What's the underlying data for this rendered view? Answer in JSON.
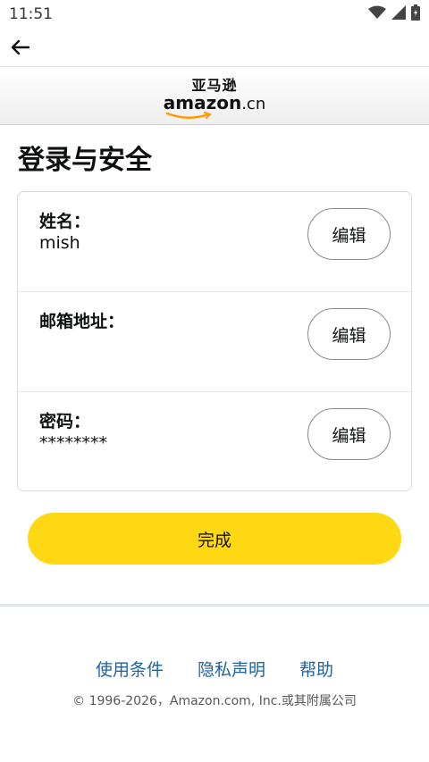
{
  "status_bar": {
    "time": "11:51"
  },
  "logo": {
    "cn": "亚马逊",
    "en": "amazon",
    "suffix": ".cn"
  },
  "page": {
    "title": "登录与安全"
  },
  "rows": [
    {
      "label": "姓名：",
      "value": "mish",
      "button": "编辑"
    },
    {
      "label": "邮箱地址：",
      "value": "",
      "button": "编辑"
    },
    {
      "label": "密码：",
      "value": "********",
      "button": "编辑"
    }
  ],
  "done_button": "完成",
  "footer": {
    "links": [
      "使用条件",
      "隐私声明",
      "帮助"
    ],
    "copyright": "© 1996-2026，Amazon.com, Inc.或其附属公司"
  },
  "colors": {
    "accent": "#ffd814",
    "link": "#2162a1",
    "border": "#d5d9d9"
  }
}
